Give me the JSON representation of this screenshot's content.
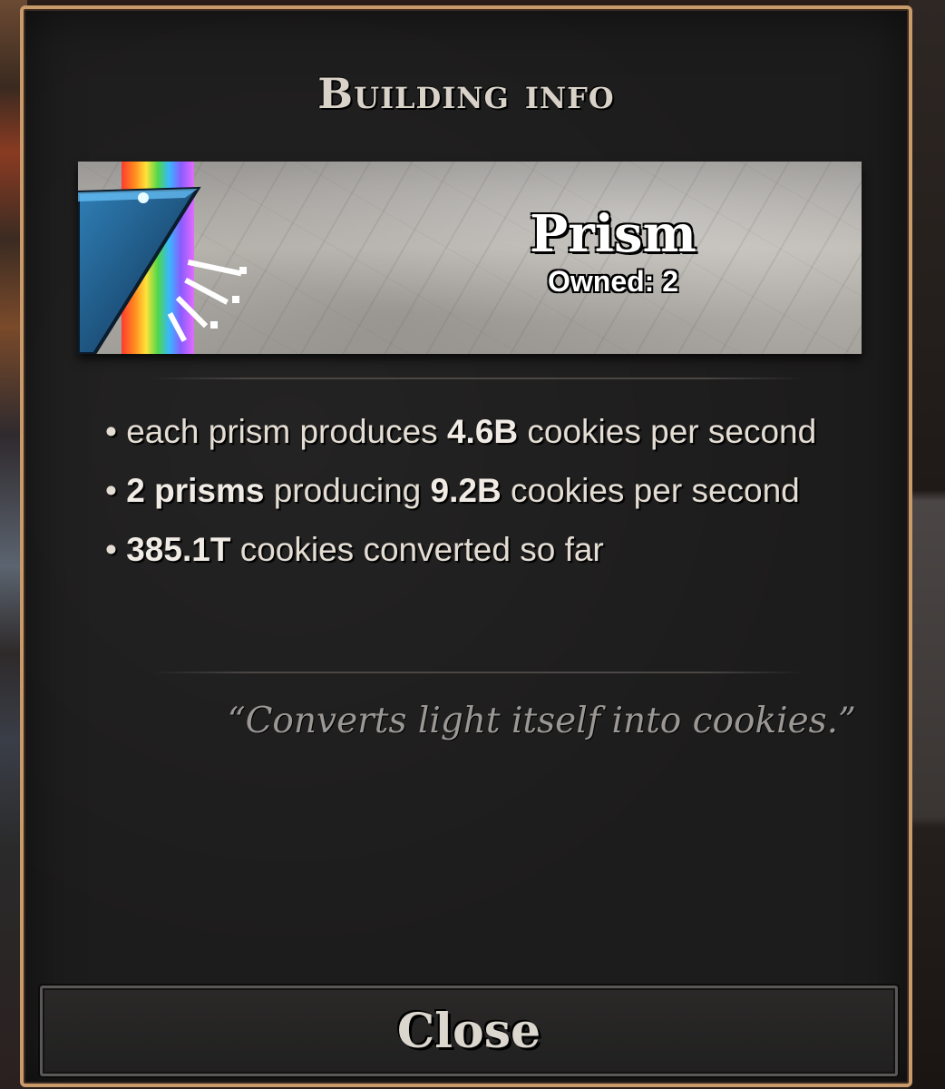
{
  "dialog": {
    "title": "Building info",
    "building": {
      "name": "Prism",
      "owned": "Owned: 2",
      "icon": "prism-icon"
    },
    "stats": [
      {
        "pre": "each prism produces ",
        "bold": "4.6B",
        "post": " cookies per second"
      },
      {
        "bold_pre": "2 prisms",
        "mid": " producing ",
        "bold": "9.2B",
        "post": " cookies per second"
      },
      {
        "bold": "385.1T",
        "post": " cookies converted so far"
      }
    ],
    "quote": "“Converts light itself into cookies.”",
    "close_label": "Close"
  },
  "colors": {
    "frame": "#c99a6a",
    "panel": "#1d1c1c",
    "text": "#e4ddd4",
    "quote": "#9a9794"
  }
}
